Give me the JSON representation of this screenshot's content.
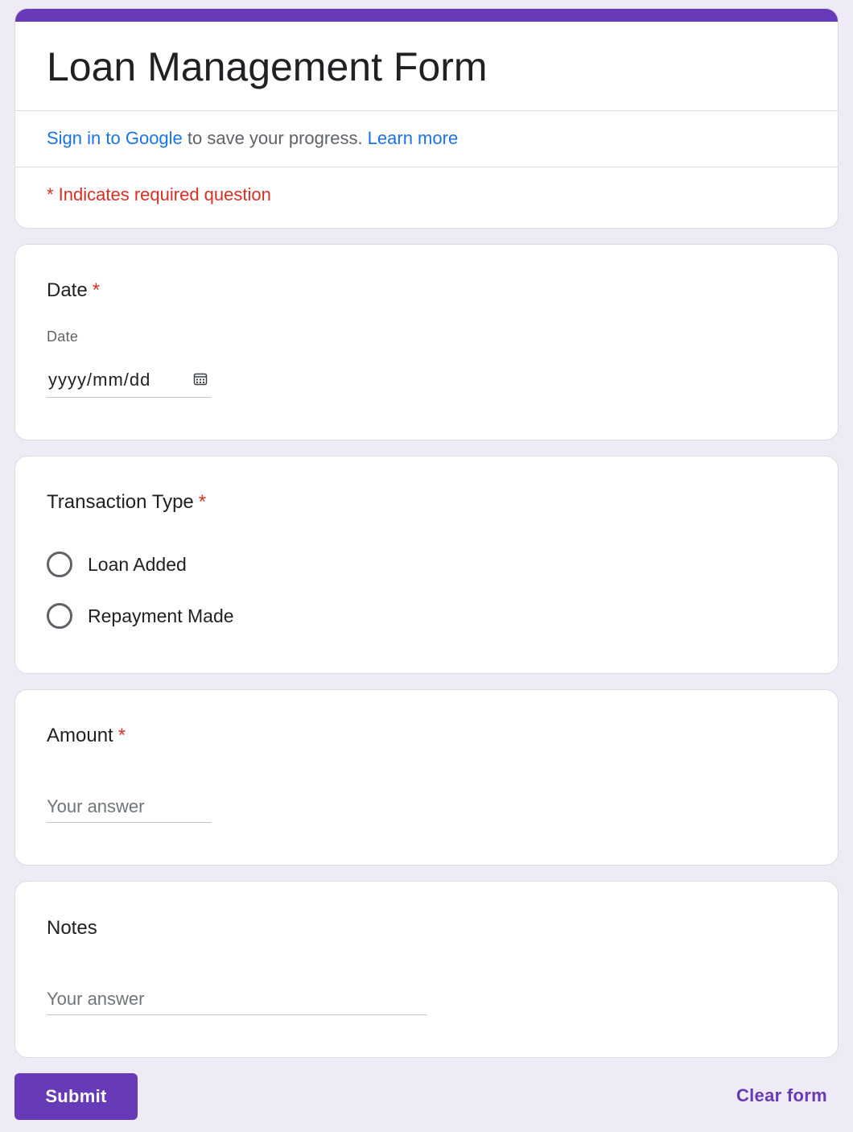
{
  "header": {
    "accent_color": "#673ab7",
    "title": "Loan Management Form",
    "signin_link": "Sign in to Google",
    "signin_text": " to save your progress. ",
    "learn_more_link": "Learn more",
    "required_note": "* Indicates required question"
  },
  "questions": {
    "date": {
      "title": "Date",
      "required_mark": "*",
      "sublabel": "Date",
      "value": "yyyy/mm/dd",
      "icon": "calendar-icon"
    },
    "transaction_type": {
      "title": "Transaction Type",
      "required_mark": "*",
      "options": [
        {
          "label": "Loan Added",
          "selected": false
        },
        {
          "label": "Repayment Made",
          "selected": false
        }
      ]
    },
    "amount": {
      "title": "Amount",
      "required_mark": "*",
      "placeholder": "Your answer"
    },
    "notes": {
      "title": "Notes",
      "placeholder": "Your answer"
    }
  },
  "actions": {
    "submit_label": "Submit",
    "clear_label": "Clear form"
  },
  "colors": {
    "background": "#efebf6",
    "accent": "#673ab7",
    "link": "#1a73e8",
    "required": "#d93025"
  }
}
